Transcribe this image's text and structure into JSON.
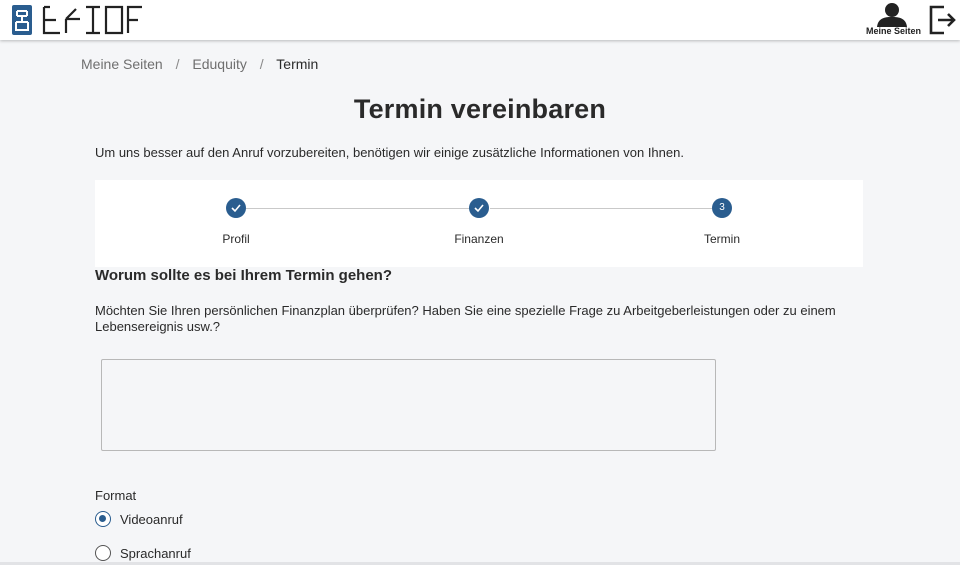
{
  "header": {
    "logo_icon": "equity-logo-icon",
    "user_label": "Meine Seiten",
    "user_icon": "user-icon",
    "logout_icon": "logout-icon"
  },
  "breadcrumb": {
    "items": [
      "Meine Seiten",
      "Eduquity",
      "Termin"
    ],
    "separator": "/"
  },
  "page": {
    "title": "Termin vereinbaren",
    "intro": "Um uns besser auf den Anruf vorzubereiten, benötigen wir einige zusätzliche Informationen von Ihnen."
  },
  "stepper": {
    "steps": [
      {
        "label": "Profil",
        "state": "done",
        "icon": "checkmark-icon"
      },
      {
        "label": "Finanzen",
        "state": "done",
        "icon": "checkmark-icon"
      },
      {
        "label": "Termin",
        "state": "current",
        "number": "3"
      }
    ]
  },
  "form": {
    "question": "Worum sollte es bei Ihrem Termin gehen?",
    "description": "Möchten Sie Ihren persönlichen Finanzplan überprüfen? Haben Sie eine spezielle Frage zu Arbeitgeberleistungen oder zu einem Lebensereignis usw.?",
    "textarea_value": "",
    "format_label": "Format",
    "options": [
      {
        "label": "Videoanruf",
        "checked": true
      },
      {
        "label": "Sprachanruf",
        "checked": false
      }
    ]
  },
  "colors": {
    "accent": "#2a5d8f",
    "background": "#f5f6f8"
  }
}
